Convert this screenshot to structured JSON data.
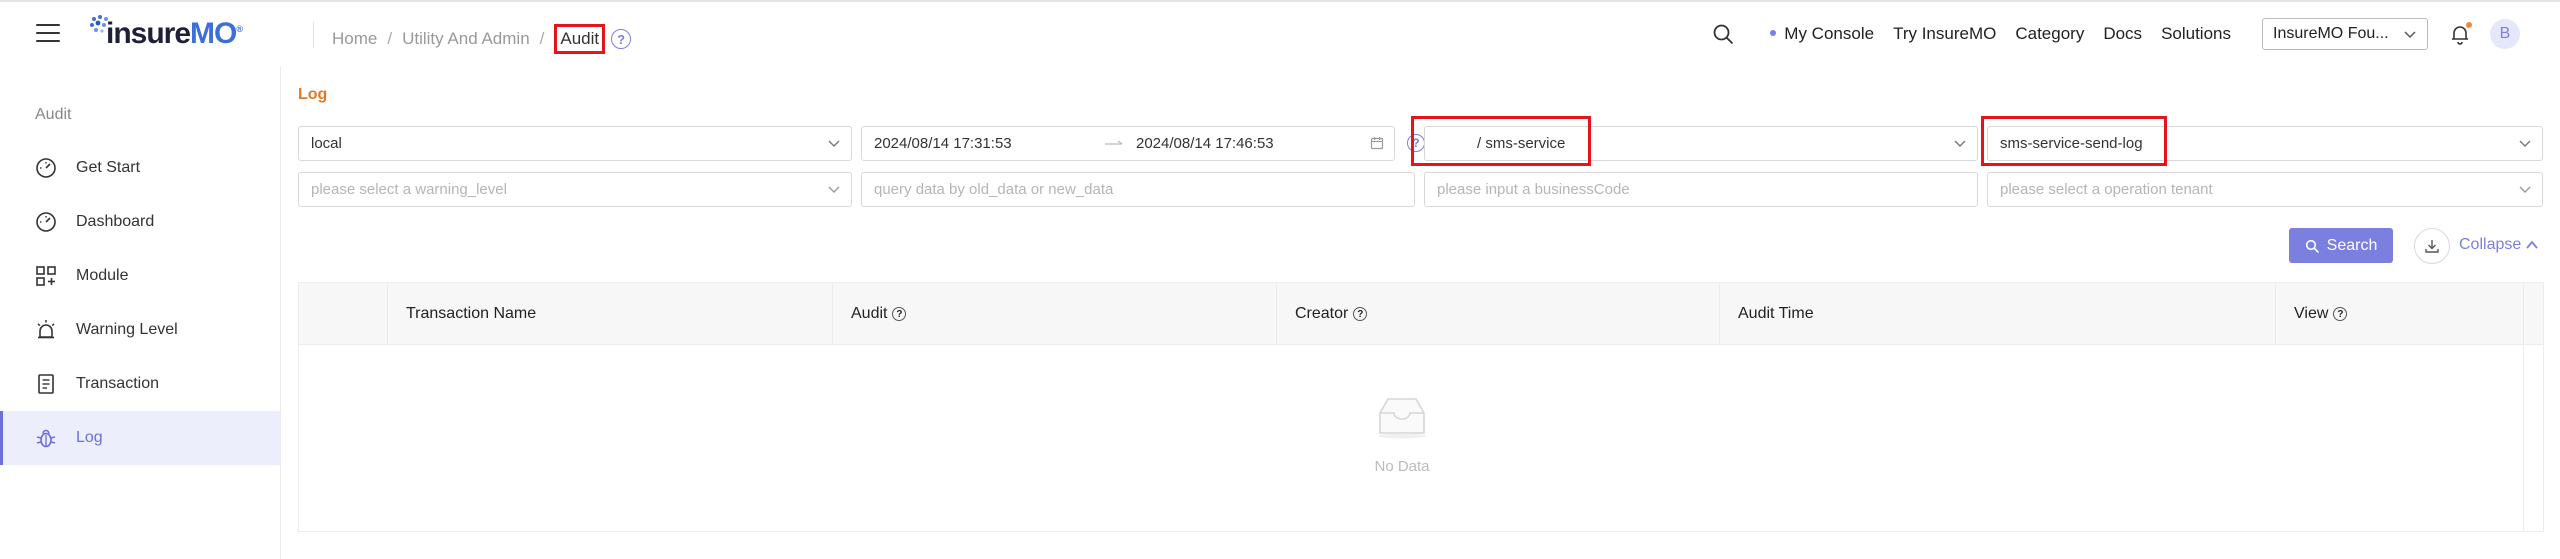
{
  "header": {
    "logo_a": "insure",
    "logo_b": "MO",
    "logo_tm": "®",
    "breadcrumb": [
      "Home",
      "Utility And Admin",
      "Audit"
    ],
    "breadcrumb_sep": "/",
    "help": "?",
    "nav": [
      "My Console",
      "Try InsureMO",
      "Category",
      "Docs",
      "Solutions"
    ],
    "tenant": "InsureMO Fou...",
    "avatar": "B"
  },
  "sidebar": {
    "title": "Audit",
    "items": [
      {
        "label": "Get Start",
        "icon": "gauge-icon"
      },
      {
        "label": "Dashboard",
        "icon": "gauge-icon"
      },
      {
        "label": "Module",
        "icon": "module-icon"
      },
      {
        "label": "Warning Level",
        "icon": "alarm-icon"
      },
      {
        "label": "Transaction",
        "icon": "document-icon"
      },
      {
        "label": "Log",
        "icon": "bug-icon",
        "active": true
      }
    ]
  },
  "main": {
    "title": "Log",
    "filters": {
      "env": "local",
      "start_time": "2024/08/14 17:31:53",
      "end_time": "2024/08/14 17:46:53",
      "service": "/ sms-service",
      "transaction": "sms-service-send-log",
      "warning_placeholder": "please select a warning_level",
      "data_placeholder": "query data by old_data or new_data",
      "business_placeholder": "please input a businessCode",
      "tenant_placeholder": "please select a operation tenant"
    },
    "search_label": "Search",
    "collapse_label": "Collapse",
    "table": {
      "columns": [
        "Transaction Name",
        "Audit",
        "Creator",
        "Audit Time",
        "View"
      ],
      "empty_text": "No Data"
    }
  },
  "colors": {
    "accent": "#7b7fe0",
    "highlight": "#e0161a",
    "title": "#e07a2a"
  }
}
